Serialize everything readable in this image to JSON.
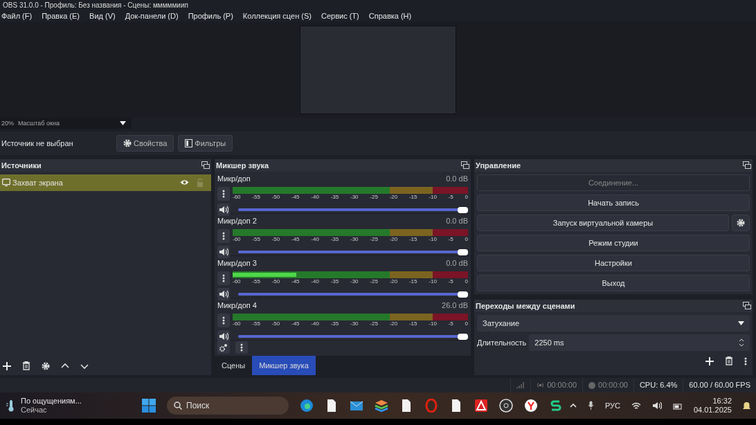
{
  "window": {
    "title": "OBS 31.0.0 - Профиль: Без названия - Сцены: мммммиип"
  },
  "menu": [
    "Файл (F)",
    "Правка (E)",
    "Вид (V)",
    "Док-панели (D)",
    "Профиль (P)",
    "Коллекция сцен (S)",
    "Сервис (T)",
    "Справка (H)"
  ],
  "preview": {
    "zoom": "20%",
    "scale_mode": "Масштаб окна"
  },
  "source_toolbar": {
    "status": "Источник не выбран",
    "properties": "Свойства",
    "filters": "Фильтры"
  },
  "sources": {
    "title": "Источники",
    "items": [
      {
        "name": "Захват экрана",
        "selected": true,
        "visible": true,
        "locked": false
      }
    ]
  },
  "mixer": {
    "title": "Микшер звука",
    "channels": [
      {
        "name": "Микр/доп",
        "reading": "0.0 dB",
        "meter": {
          "level": 0
        },
        "fader": {
          "level": 1
        },
        "muted": false,
        "scale": [
          "-60",
          "-55",
          "-50",
          "-45",
          "-40",
          "-35",
          "-30",
          "-25",
          "-20",
          "-15",
          "-10",
          "-5",
          "0"
        ]
      },
      {
        "name": "Микр/доп 2",
        "reading": "0.0 dB",
        "meter": {
          "level": 0
        },
        "fader": {
          "level": 1
        },
        "muted": false,
        "scale": [
          "-60",
          "-55",
          "-50",
          "-45",
          "-40",
          "-35",
          "-30",
          "-25",
          "-20",
          "-15",
          "-10",
          "-5",
          "0"
        ]
      },
      {
        "name": "Микр/доп 3",
        "reading": "0.0 dB",
        "meter": {
          "level": 0.27
        },
        "fader": {
          "level": 1
        },
        "muted": false,
        "scale": [
          "-60",
          "-55",
          "-50",
          "-45",
          "-40",
          "-35",
          "-30",
          "-25",
          "-20",
          "-15",
          "-10",
          "-5",
          "0"
        ]
      },
      {
        "name": "Микр/доп 4",
        "reading": "26.0 dB",
        "meter": {
          "level": 0
        },
        "fader": {
          "level": 1
        },
        "muted": false,
        "scale": [
          "-60",
          "-55",
          "-50",
          "-45",
          "-40",
          "-35",
          "-30",
          "-25",
          "-20",
          "-15",
          "-10",
          "-5",
          "0"
        ]
      }
    ]
  },
  "dock_tabs": [
    {
      "label": "Сцены",
      "selected": false
    },
    {
      "label": "Микшер звука",
      "selected": true
    }
  ],
  "controls": {
    "title": "Управление",
    "buttons": [
      {
        "label": "Соединение...",
        "disabled": true,
        "kind": "plain"
      },
      {
        "label": "Начать запись",
        "disabled": false,
        "kind": "plain"
      },
      {
        "label": "Запуск виртуальной камеры",
        "disabled": false,
        "kind": "with-settings"
      },
      {
        "label": "Режим студии",
        "disabled": false,
        "kind": "plain"
      },
      {
        "label": "Настройки",
        "disabled": false,
        "kind": "plain"
      },
      {
        "label": "Выход",
        "disabled": false,
        "kind": "plain"
      }
    ]
  },
  "transitions": {
    "title": "Переходы между сценами",
    "transition": "Затухание",
    "duration_label": "Длительность",
    "duration": "2250 ms"
  },
  "status_bar": {
    "stream_time": "00:00:00",
    "record_time": "00:00:00",
    "cpu": "CPU: 6.4%",
    "fps": "60.00 / 60.00 FPS"
  },
  "taskbar": {
    "weather": "По ощущениям...",
    "weather_note": "Сейчас",
    "search_placeholder": "Поиск",
    "language": "РУС",
    "time": "16:32",
    "date": "04.01.2025"
  }
}
